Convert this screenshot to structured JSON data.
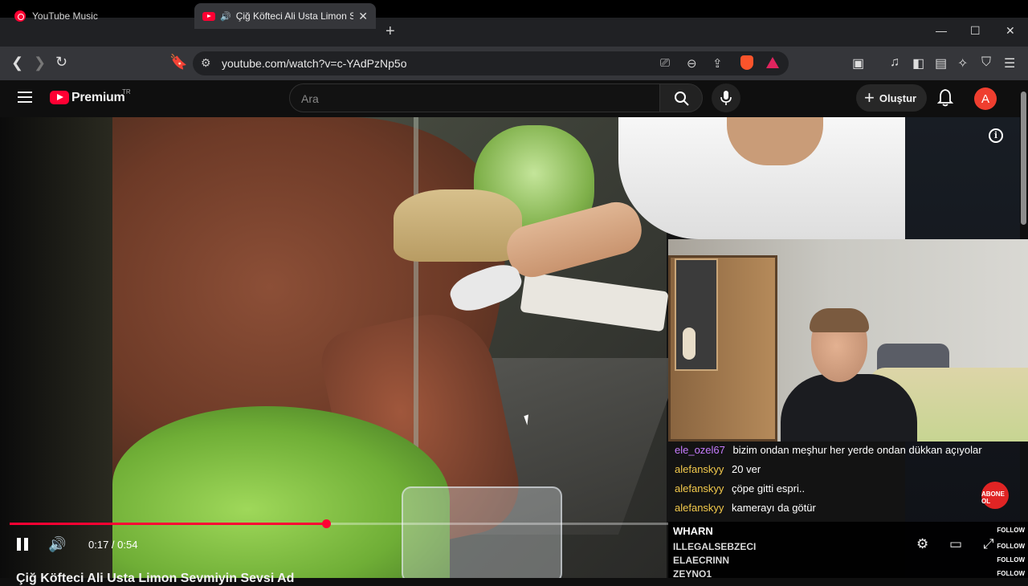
{
  "browser": {
    "tabs": [
      {
        "label": "YouTube Music"
      },
      {
        "label": "Çiğ Köfteci Ali Usta Limon Sev"
      }
    ],
    "address": "youtube.com/watch?v=c-YAdPzNp5o"
  },
  "youtube": {
    "brand": "Premium",
    "region": "TR",
    "search_placeholder": "Ara",
    "create_label": "Oluştur",
    "avatar_letter": "A"
  },
  "player": {
    "current_time": "0:17",
    "duration": "0:54",
    "time_display": "0:17 / 0:54",
    "progress_fraction": 0.48,
    "video_title_partial": "Çiğ Köfteci Ali Usta Limon Sevmiyin Sevsi Ad"
  },
  "chat": {
    "messages": [
      {
        "user": "ele_ozel67",
        "text": "bizim ondan meşhur her yerde ondan dükkan açıyolar",
        "color": "#c77dff"
      },
      {
        "user": "alefanskyy",
        "text": "20 ver",
        "color": "#f2c94c"
      },
      {
        "user": "alefanskyy",
        "text": "çöpe gitti espri..",
        "color": "#f2c94c"
      },
      {
        "user": "alefanskyy",
        "text": "kamerayı da götür",
        "color": "#f2c94c"
      }
    ]
  },
  "overlay": {
    "subscribe_badge": "ABONE OL",
    "followers": [
      {
        "name": "WHARN",
        "tag": "FOLLOW"
      },
      {
        "name": "ILLEGALSEBZECI",
        "tag": "FOLLOW"
      },
      {
        "name": "ELAECRINN",
        "tag": "FOLLOW"
      },
      {
        "name": "ZEYNO1",
        "tag": "FOLLOW"
      }
    ]
  },
  "colors": {
    "accent": "#ff0033",
    "chat_user_purple": "#c77dff",
    "chat_user_yellow": "#f2c94c"
  }
}
